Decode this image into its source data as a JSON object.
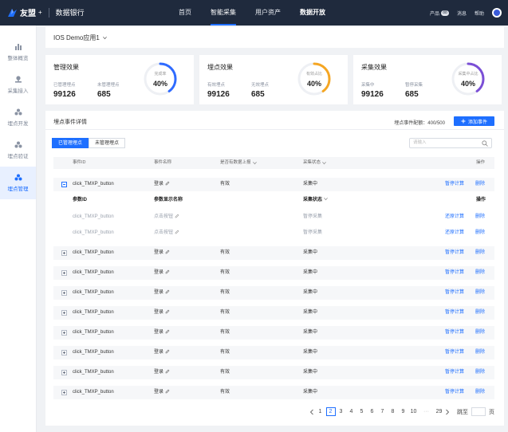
{
  "topbar": {
    "brand": "友盟",
    "brand_suffix": "+",
    "product": "数据银行",
    "nav": [
      {
        "label": "首页"
      },
      {
        "label": "智能采集"
      },
      {
        "label": "用户资产"
      },
      {
        "label": "数据开放"
      }
    ],
    "right": {
      "products": "产品",
      "products_badge": "88",
      "messages": "消息",
      "help": "帮助"
    }
  },
  "sidebar": {
    "items": [
      {
        "label": "整体概览",
        "icon": "bar-chart-icon"
      },
      {
        "label": "采集接入",
        "icon": "pin-icon"
      },
      {
        "label": "埋点开发",
        "icon": "nodes-icon"
      },
      {
        "label": "埋点验证",
        "icon": "nodes-icon"
      },
      {
        "label": "埋点管理",
        "icon": "nodes-icon"
      }
    ]
  },
  "app_selector": {
    "value": "IOS Demo应用1"
  },
  "cards": [
    {
      "title": "管理效果",
      "left_label": "已管理埋点",
      "left_value": "99126",
      "right_label": "未管理埋点",
      "right_value": "685",
      "ring_label": "完成率",
      "ring_pct": "40%",
      "progress": 0.4,
      "color": "#2f6bff"
    },
    {
      "title": "埋点效果",
      "left_label": "有效埋点",
      "left_value": "99126",
      "right_label": "无效埋点",
      "right_value": "685",
      "ring_label": "有效占比",
      "ring_pct": "40%",
      "progress": 0.4,
      "color": "#f5a623"
    },
    {
      "title": "采集效果",
      "left_label": "采集中",
      "left_value": "99126",
      "right_label": "暂停采集",
      "right_value": "685",
      "ring_label": "采集中占比",
      "ring_pct": "40%",
      "progress": 0.4,
      "color": "#7b4fd6"
    }
  ],
  "panel": {
    "title": "埋点事件详情",
    "quota": "埋点事件配额：400/500",
    "add_button": "添加事件",
    "tabs": [
      "已管理埋点",
      "未管理埋点"
    ],
    "search_placeholder": "请输入"
  },
  "table": {
    "headers": {
      "event_id": "事件ID",
      "event_name": "事件名称",
      "reported": "是否有数据上报",
      "status": "采集状态",
      "ops": "操作"
    },
    "expanded_row": {
      "event_id": "click_TMXP_button",
      "event_name": "登录",
      "reported": "有效",
      "status": "采集中",
      "action1": "暂停计算",
      "action2": "删除"
    },
    "sub_headers": {
      "param_id": "参数ID",
      "param_name": "参数显示名称",
      "status": "采集状态",
      "ops": "操作"
    },
    "sub_rows": [
      {
        "param_id": "click_TMXP_button",
        "param_name": "点击按钮",
        "status": "暂停采集",
        "action1": "还原计算",
        "action2": "删除"
      },
      {
        "param_id": "click_TMXP_button",
        "param_name": "点击按钮",
        "status": "暂停采集",
        "action1": "还原计算",
        "action2": "删除"
      }
    ],
    "rows": [
      {
        "event_id": "click_TMXP_button",
        "event_name": "登录",
        "reported": "有效",
        "status": "采集中",
        "action1": "暂停计算",
        "action2": "删除"
      },
      {
        "event_id": "click_TMXP_button",
        "event_name": "登录",
        "reported": "有效",
        "status": "采集中",
        "action1": "暂停计算",
        "action2": "删除"
      },
      {
        "event_id": "click_TMXP_button",
        "event_name": "登录",
        "reported": "有效",
        "status": "采集中",
        "action1": "暂停计算",
        "action2": "删除"
      },
      {
        "event_id": "click_TMXP_button",
        "event_name": "登录",
        "reported": "有效",
        "status": "采集中",
        "action1": "暂停计算",
        "action2": "删除"
      },
      {
        "event_id": "click_TMXP_button",
        "event_name": "登录",
        "reported": "有效",
        "status": "采集中",
        "action1": "暂停计算",
        "action2": "删除"
      },
      {
        "event_id": "click_TMXP_button",
        "event_name": "登录",
        "reported": "有效",
        "status": "采集中",
        "action1": "暂停计算",
        "action2": "删除"
      },
      {
        "event_id": "click_TMXP_button",
        "event_name": "登录",
        "reported": "有效",
        "status": "采集中",
        "action1": "暂停计算",
        "action2": "删除"
      },
      {
        "event_id": "click_TMXP_button",
        "event_name": "登录",
        "reported": "有效",
        "status": "采集中",
        "action1": "暂停计算",
        "action2": "删除"
      }
    ]
  },
  "pagination": {
    "pages": [
      "1",
      "2",
      "3",
      "4",
      "5",
      "6",
      "7",
      "8",
      "9",
      "10",
      "···",
      "29"
    ],
    "current": "2",
    "jump_label": "跳至",
    "page_unit": "页"
  }
}
